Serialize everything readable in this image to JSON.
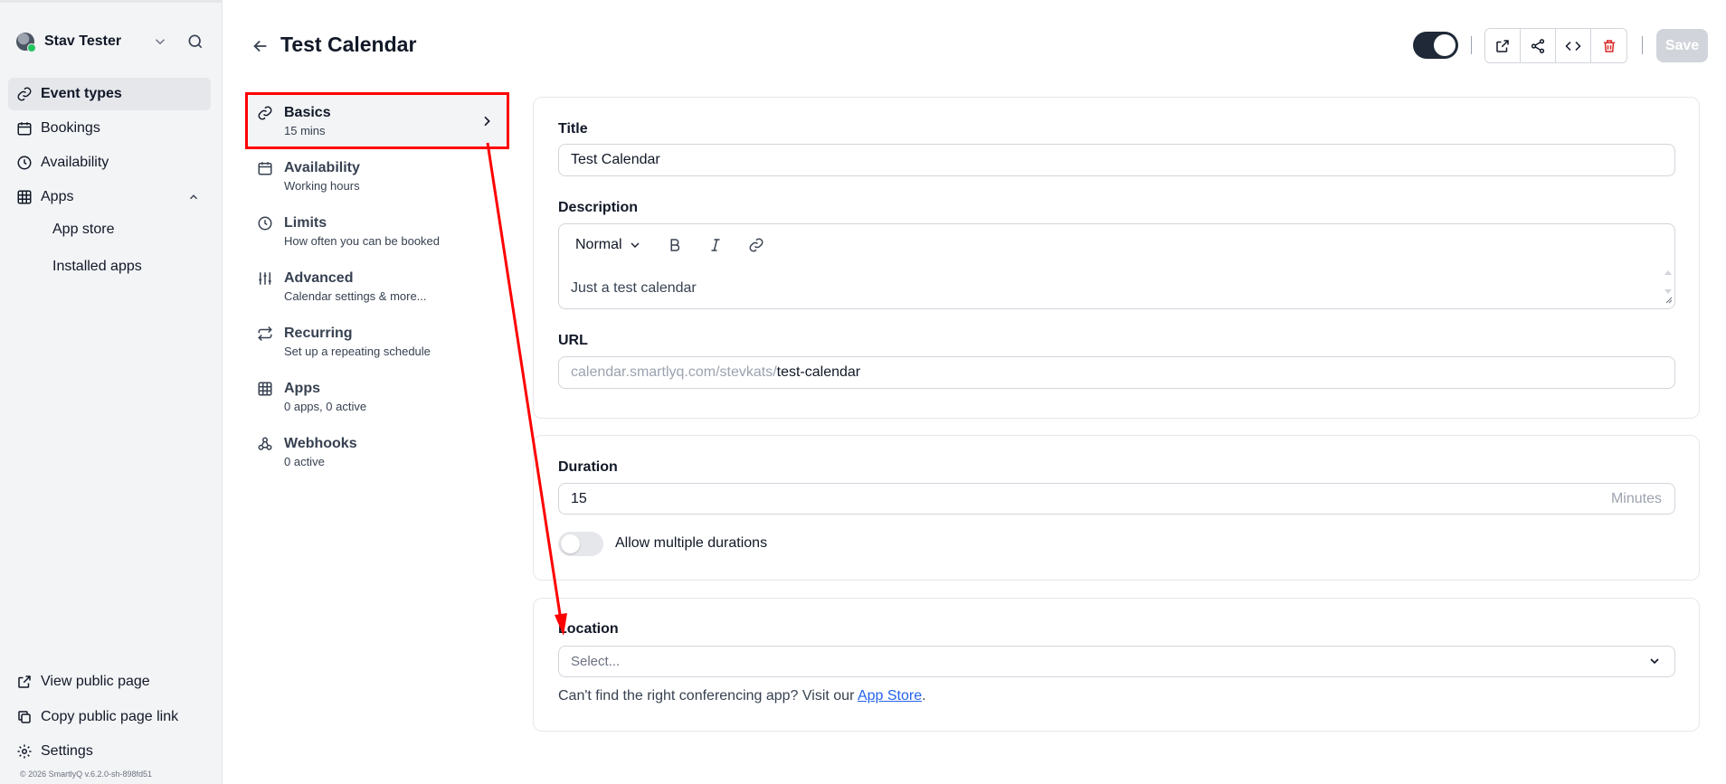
{
  "sidebar": {
    "user_name": "Stav Tester",
    "nav": [
      {
        "label": "Event types",
        "icon": "link-icon",
        "active": true
      },
      {
        "label": "Bookings",
        "icon": "calendar-icon"
      },
      {
        "label": "Availability",
        "icon": "clock-icon"
      },
      {
        "label": "Apps",
        "icon": "grid-icon",
        "expanded": true
      }
    ],
    "apps_sub": [
      "App store",
      "Installed apps"
    ],
    "bottom": [
      {
        "label": "View public page",
        "icon": "external-link-icon"
      },
      {
        "label": "Copy public page link",
        "icon": "copy-icon"
      },
      {
        "label": "Settings",
        "icon": "gear-icon"
      }
    ],
    "copyright": "© 2026 SmartlyQ v.6.2.0-sh-898fd51"
  },
  "header": {
    "title": "Test Calendar",
    "save_label": "Save",
    "hidden_toggle_on": true
  },
  "tabs": [
    {
      "title": "Basics",
      "subtitle": "15 mins",
      "icon": "link-icon",
      "active": true
    },
    {
      "title": "Availability",
      "subtitle": "Working hours",
      "icon": "calendar-icon"
    },
    {
      "title": "Limits",
      "subtitle": "How often you can be booked",
      "icon": "clock-icon"
    },
    {
      "title": "Advanced",
      "subtitle": "Calendar settings & more...",
      "icon": "sliders-icon"
    },
    {
      "title": "Recurring",
      "subtitle": "Set up a repeating schedule",
      "icon": "repeat-icon"
    },
    {
      "title": "Apps",
      "subtitle": "0 apps, 0 active",
      "icon": "grid-icon"
    },
    {
      "title": "Webhooks",
      "subtitle": "0 active",
      "icon": "webhook-icon"
    }
  ],
  "form": {
    "title_label": "Title",
    "title_value": "Test Calendar",
    "description_label": "Description",
    "editor_style": "Normal",
    "description_value": "Just a test calendar",
    "url_label": "URL",
    "url_prefix": "calendar.smartlyq.com/stevkats/",
    "url_slug": "test-calendar",
    "duration_label": "Duration",
    "duration_value": "15",
    "duration_unit": "Minutes",
    "multiple_durations_label": "Allow multiple durations",
    "multiple_durations_on": false,
    "location_label": "Location",
    "location_placeholder": "Select...",
    "help_prefix": "Can't find the right conferencing app? Visit our ",
    "help_link": "App Store",
    "help_suffix": "."
  },
  "colors": {
    "highlight": "#ff0000",
    "link": "#2563eb",
    "toggle_on": "#1f2937",
    "delete": "#dc2626"
  }
}
